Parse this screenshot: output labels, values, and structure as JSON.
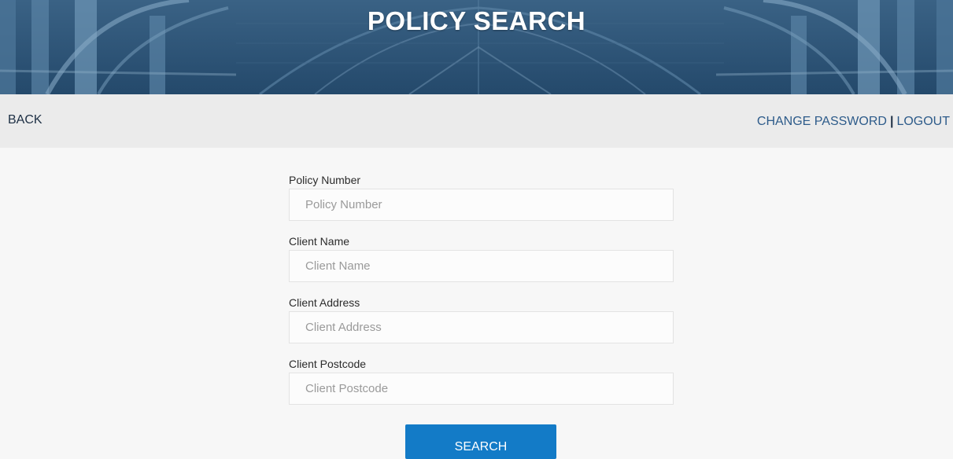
{
  "header": {
    "title": "POLICY SEARCH"
  },
  "nav": {
    "back_label": "BACK",
    "change_password_label": "CHANGE PASSWORD",
    "separator": "|",
    "logout_label": "LOGOUT"
  },
  "form": {
    "fields": [
      {
        "label": "Policy Number",
        "placeholder": "Policy Number",
        "value": ""
      },
      {
        "label": "Client Name",
        "placeholder": "Client Name",
        "value": ""
      },
      {
        "label": "Client Address",
        "placeholder": "Client Address",
        "value": ""
      },
      {
        "label": "Client Postcode",
        "placeholder": "Client Postcode",
        "value": ""
      }
    ],
    "search_label": "SEARCH"
  },
  "colors": {
    "banner": "#2f5577",
    "nav_background": "#ebebeb",
    "link": "#2d5b8a",
    "button": "#137bc7",
    "page_background": "#f7f7f7"
  }
}
